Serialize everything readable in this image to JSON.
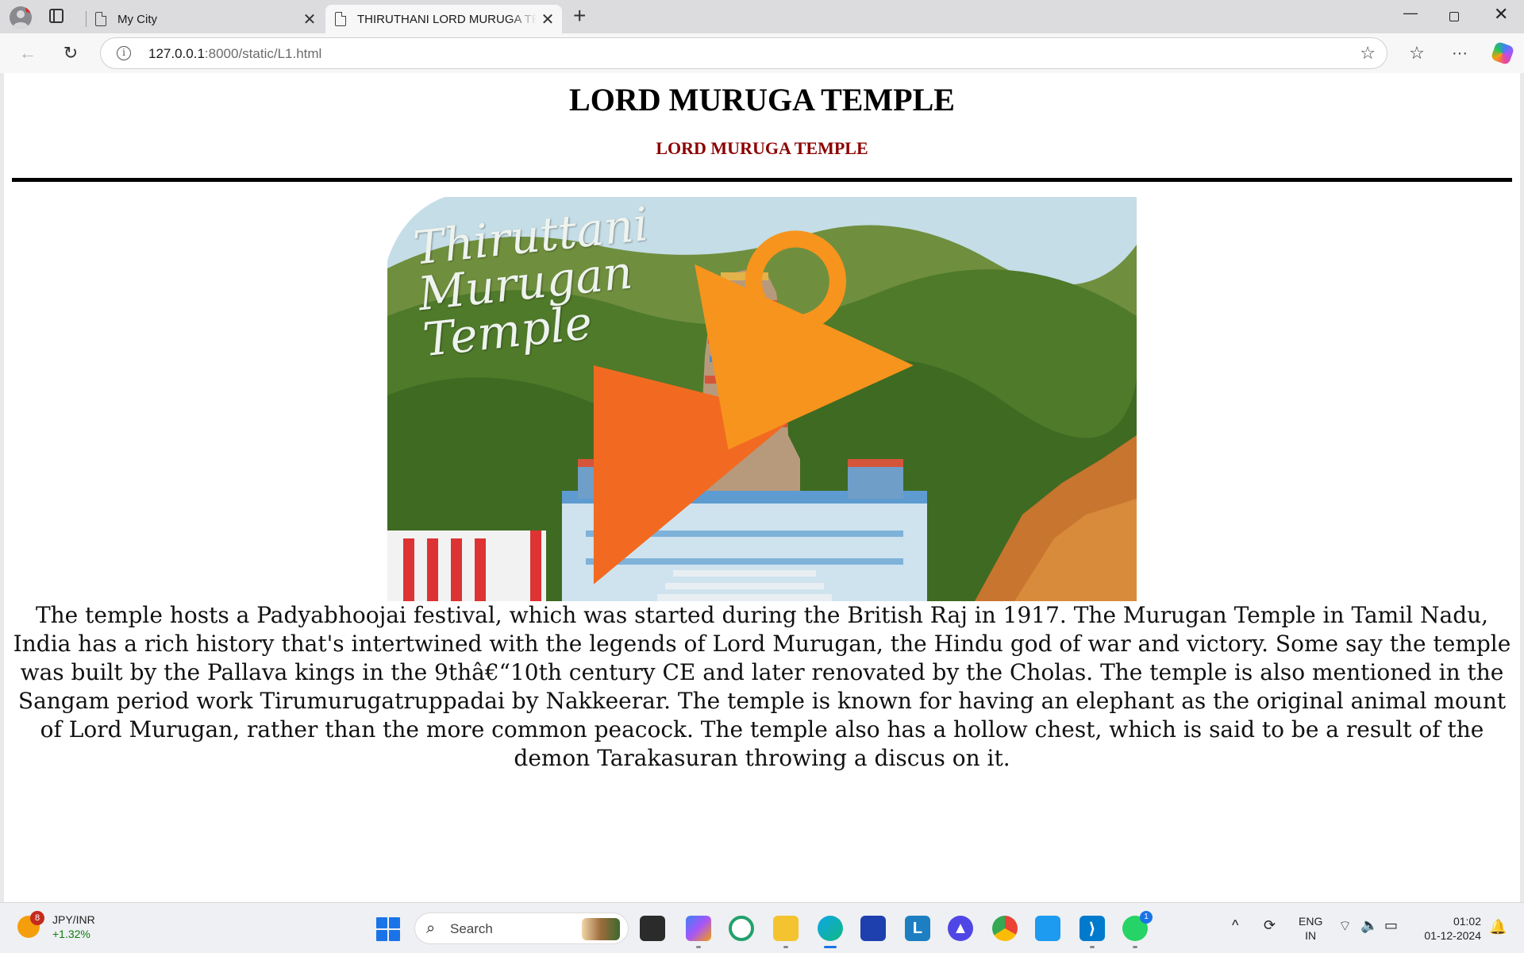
{
  "browser": {
    "tabs": [
      {
        "title": "My City",
        "active": false
      },
      {
        "title": "THIRUTHANI LORD MURUGA TEMPLE",
        "active": true
      }
    ],
    "url_host": "127.0.0.1",
    "url_rest": ":8000/static/L1.html",
    "icons": [
      "profile-icon",
      "tab-actions-icon",
      "page-icon",
      "close-icon",
      "new-tab-icon",
      "back-icon",
      "refresh-icon",
      "info-icon",
      "star-icon",
      "favorites-icon",
      "more-icon",
      "copilot-icon",
      "minimize-icon",
      "restore-icon",
      "close-window-icon"
    ]
  },
  "page": {
    "title": "LORD MURUGA TEMPLE",
    "subtitle": "LORD MURUGA TEMPLE",
    "subtitle_color": "#8b0000",
    "hero_caption": "Thiruttani Murugan Temple",
    "article": "The temple hosts a Padyabhoojai festival, which was started during the British Raj in 1917. The Murugan Temple in Tamil Nadu, India has a rich history that's intertwined with the legends of Lord Murugan, the Hindu god of war and victory. Some say the temple was built by the Pallava kings in the 9thâ€“10th century CE and later renovated by the Cholas. The temple is also mentioned in the Sangam period work Tirumurugatruppadai by Nakkeerar. The temple is known for having an elephant as the original animal mount of Lord Murugan, rather than the more common peacock. The temple also has a hollow chest, which is said to be a result of the demon Tarakasuran throwing a discus on it."
  },
  "taskbar": {
    "widget_badge": "8",
    "widget_title": "JPY/INR",
    "widget_change": "+1.32%",
    "search_label": "Search",
    "whatsapp_badge": "1",
    "lang_top": "ENG",
    "lang_bottom": "IN",
    "time": "01:02",
    "date": "01-12-2024",
    "accent": "#1a73e8"
  }
}
